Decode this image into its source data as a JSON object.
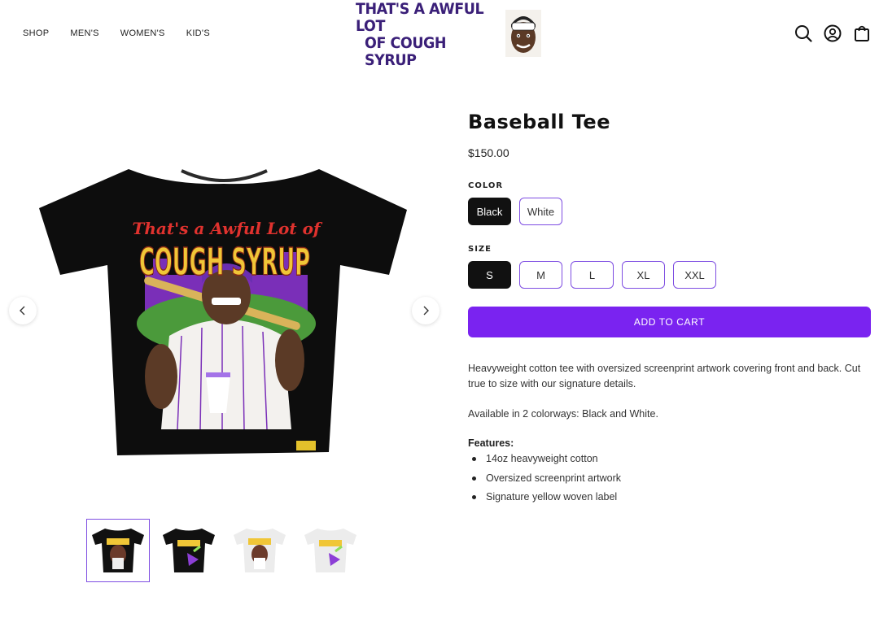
{
  "header": {
    "nav": [
      "SHOP",
      "MEN'S",
      "WOMEN'S",
      "KID'S"
    ],
    "logo_line1": "THAT'S A AWFUL LOT",
    "logo_line2": "OF COUGH SYRUP",
    "icons": [
      "search-icon",
      "account-icon",
      "bag-icon"
    ]
  },
  "gallery": {
    "shirt_text_top": "That's a Awful Lot of",
    "shirt_text_main": "COUGH SYRUP",
    "prev_icon": "chevron-left-icon",
    "next_icon": "chevron-right-icon",
    "selected_thumb": 0
  },
  "product": {
    "title": "Baseball Tee",
    "price": "$150.00",
    "color_label": "COLOR",
    "colors": [
      "Black",
      "White"
    ],
    "selected_color": "Black",
    "size_label": "SIZE",
    "sizes": [
      "S",
      "M",
      "L",
      "XL",
      "XXL"
    ],
    "selected_size": "S",
    "add_to_cart": "ADD TO CART",
    "description": "Heavyweight cotton tee with oversized screenprint artwork covering front and back. Cut true to size with our signature details.",
    "availability": "Available in 2 colorways: Black and White.",
    "features_heading": "Features:",
    "features": [
      "14oz heavyweight cotton",
      "Oversized screenprint artwork",
      "Signature yellow woven label"
    ]
  },
  "colors": {
    "accent": "#7a23f0",
    "border_accent": "#7e4de2",
    "logo": "#3a1f78"
  }
}
